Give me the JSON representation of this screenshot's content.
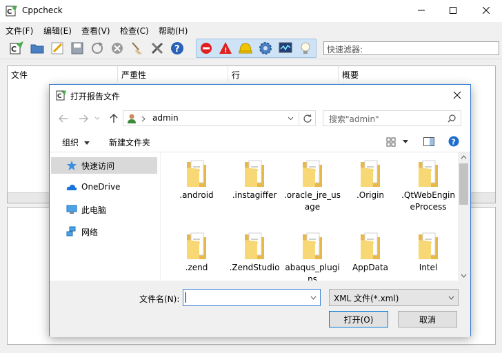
{
  "app": {
    "title": "Cppcheck",
    "menu": [
      "文件(F)",
      "编辑(E)",
      "查看(V)",
      "检查(C)",
      "帮助(H)"
    ],
    "filter_placeholder": "快速滤器:"
  },
  "results": {
    "columns": [
      "文件",
      "严重性",
      "行",
      "概要"
    ]
  },
  "dialog": {
    "title": "打开报告文件",
    "address": "admin",
    "search_placeholder": "搜索\"admin\"",
    "commands": {
      "organize": "组织",
      "new_folder": "新建文件夹"
    },
    "nav_items": [
      {
        "label": "快速访问",
        "icon": "star-icon"
      },
      {
        "label": "OneDrive",
        "icon": "cloud-icon"
      },
      {
        "label": "此电脑",
        "icon": "computer-icon"
      },
      {
        "label": "网络",
        "icon": "network-icon"
      }
    ],
    "files": [
      {
        "name": ".android"
      },
      {
        "name": ".instagiffer"
      },
      {
        "name": ".oracle_jre_usage"
      },
      {
        "name": ".Origin"
      },
      {
        "name": ".QtWebEngineProcess"
      },
      {
        "name": ".zend"
      },
      {
        "name": ".ZendStudio"
      },
      {
        "name": "abaqus_plugins"
      },
      {
        "name": "AppData"
      },
      {
        "name": "Intel"
      }
    ],
    "filename_label": "文件名(N):",
    "filename_value": "",
    "filetype": "XML 文件(*.xml)",
    "open_button": "打开(O)",
    "cancel_button": "取消"
  },
  "colors": {
    "accent": "#0078d7",
    "folder": "#f8d775",
    "toolbar_group": "#cfe3f7"
  }
}
